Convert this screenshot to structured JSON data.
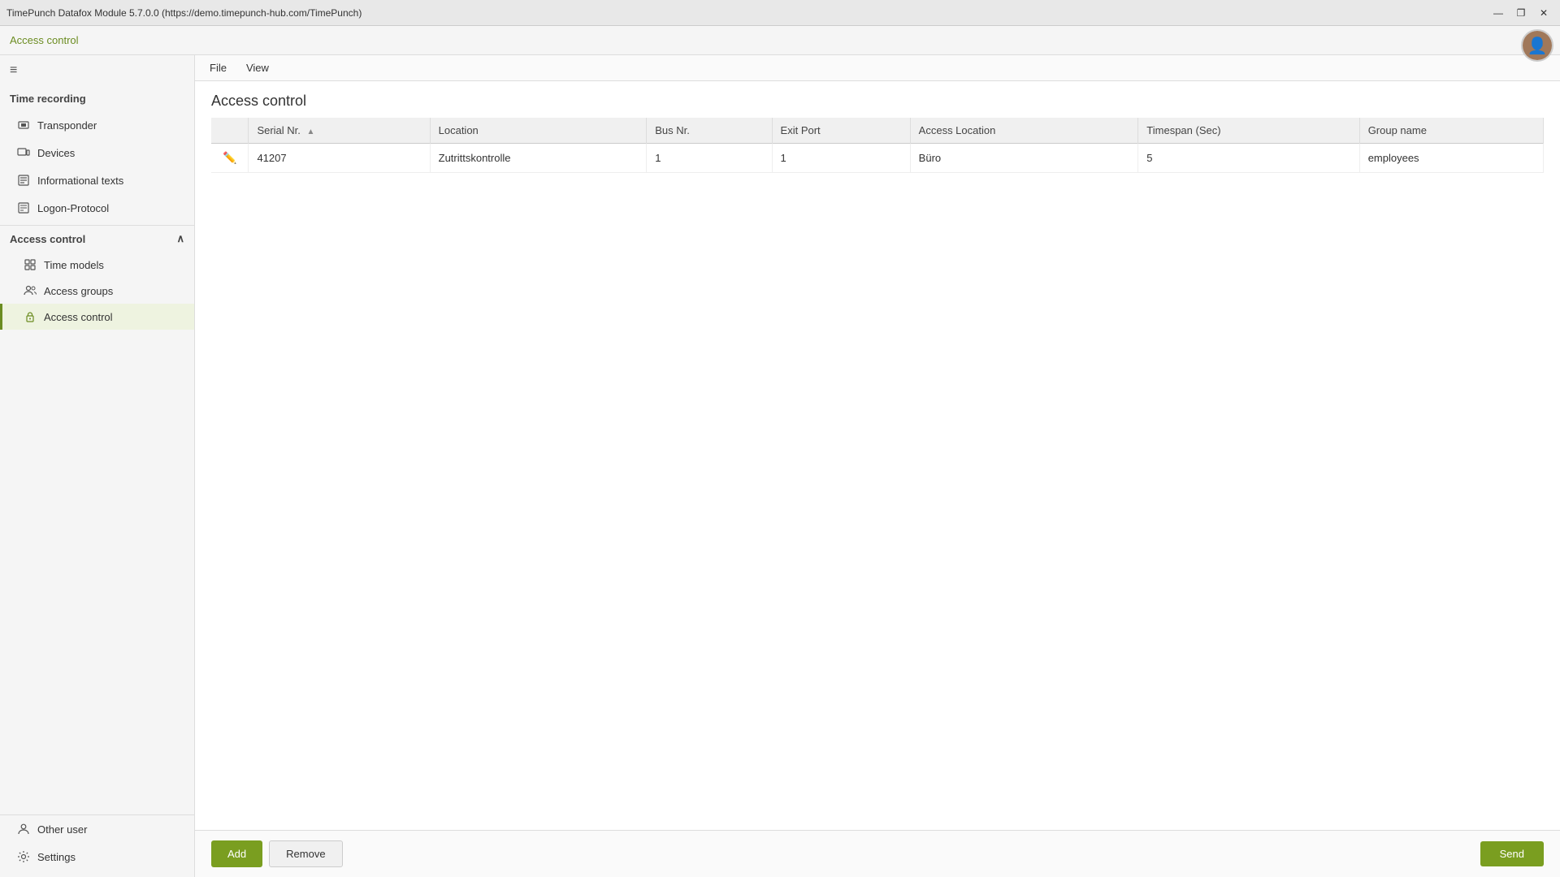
{
  "titlebar": {
    "title": "TimePunch Datafox Module 5.7.0.0 (https://demo.timepunch-hub.com/TimePunch)",
    "min_label": "—",
    "restore_label": "❐",
    "close_label": "✕"
  },
  "breadcrumb": {
    "link_label": "Access control"
  },
  "menu": {
    "file_label": "File",
    "view_label": "View"
  },
  "page": {
    "title": "Access control"
  },
  "sidebar": {
    "hamburger_icon": "≡",
    "time_recording_label": "Time recording",
    "transponder_label": "Transponder",
    "devices_label": "Devices",
    "informational_texts_label": "Informational texts",
    "logon_protocol_label": "Logon-Protocol",
    "access_control_section_label": "Access control",
    "time_models_label": "Time models",
    "access_groups_label": "Access groups",
    "access_control_label": "Access control",
    "collapse_icon": "∧",
    "other_user_label": "Other user",
    "settings_label": "Settings"
  },
  "table": {
    "columns": [
      {
        "key": "edit",
        "label": ""
      },
      {
        "key": "serial_nr",
        "label": "Serial Nr."
      },
      {
        "key": "location",
        "label": "Location"
      },
      {
        "key": "bus_nr",
        "label": "Bus Nr."
      },
      {
        "key": "exit_port",
        "label": "Exit Port"
      },
      {
        "key": "access_location",
        "label": "Access Location"
      },
      {
        "key": "timespan_sec",
        "label": "Timespan (Sec)"
      },
      {
        "key": "group_name",
        "label": "Group name"
      }
    ],
    "rows": [
      {
        "serial_nr": "41207",
        "location": "Zutrittskontrolle",
        "bus_nr": "1",
        "exit_port": "1",
        "access_location": "Büro",
        "timespan_sec": "5",
        "group_name": "employees"
      }
    ]
  },
  "buttons": {
    "add_label": "Add",
    "remove_label": "Remove",
    "send_label": "Send"
  }
}
